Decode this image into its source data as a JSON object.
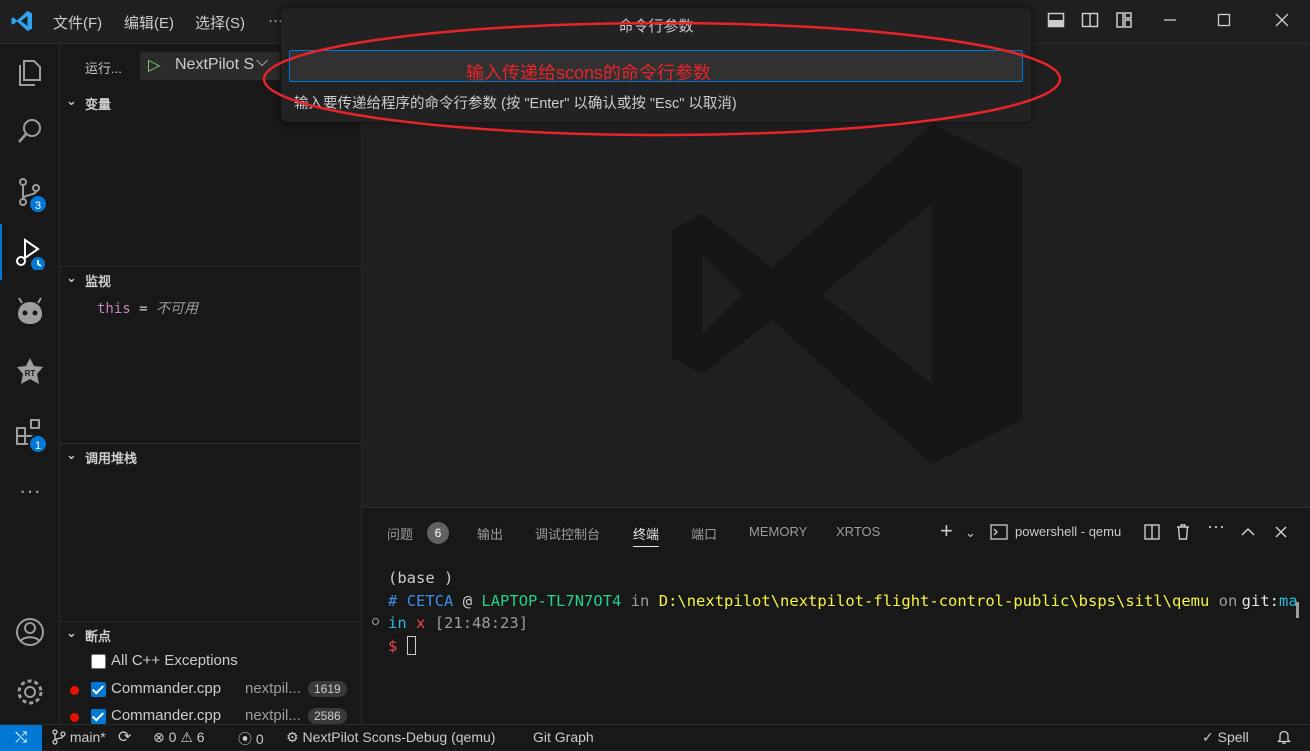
{
  "titlebar": {
    "menus": [
      "文件(F)",
      "编辑(E)",
      "选择(S)",
      "···"
    ]
  },
  "activity": {
    "scm_badge": "3",
    "extensions_badge": "1",
    "more": "···"
  },
  "sidebar": {
    "run_label": "运行...",
    "run_config": "NextPilot S",
    "variables_title": "变量",
    "watch_title": "监视",
    "watch_expr": "this",
    "watch_eq": "=",
    "watch_value": "不可用",
    "callstack_title": "调用堆栈",
    "breakpoints_title": "断点",
    "breakpoints": [
      {
        "name": "All C++ Exceptions",
        "path": "",
        "line": "",
        "checked": false,
        "dot": false
      },
      {
        "name": "Commander.cpp",
        "path": "nextpil...",
        "line": "1619",
        "checked": true,
        "dot": true
      },
      {
        "name": "Commander.cpp",
        "path": "nextpil...",
        "line": "2586",
        "checked": true,
        "dot": true
      }
    ]
  },
  "quickpick": {
    "title": "命令行参数",
    "annotation": "输入传递给scons的命令行参数",
    "hint": "输入要传递给程序的命令行参数 (按 \"Enter\" 以确认或按 \"Esc\" 以取消)"
  },
  "panel": {
    "tabs": [
      {
        "label": "问题",
        "active": false
      },
      {
        "label": "输出",
        "active": false
      },
      {
        "label": "调试控制台",
        "active": false
      },
      {
        "label": "终端",
        "active": true
      },
      {
        "label": "端口",
        "active": false
      },
      {
        "label": "MEMORY",
        "active": false
      },
      {
        "label": "XRTOS",
        "active": false
      }
    ],
    "problems_count": "6",
    "terminal_name": "powershell - qemu",
    "terminal": {
      "line1": "(base )",
      "hash": "#",
      "user": "CETCA",
      "at": "@",
      "host": "LAPTOP-TL7N7OT4",
      "in": "in",
      "path": "D:\\nextpilot\\nextpilot-flight-control-public\\bsps\\sitl\\qemu",
      "on": "on",
      "git": "git:",
      "branch_a": "ma",
      "branch_b": "in",
      "status": "x",
      "time": "[21:48:23]",
      "prompt": "$"
    }
  },
  "status": {
    "branch": "main*",
    "errors": "0",
    "warnings": "6",
    "ports": "0",
    "debug": "NextPilot Scons-Debug (qemu)",
    "git_graph": "Git Graph",
    "spell": "Spell"
  },
  "colors": {
    "accent": "#0078d4",
    "annotation_red": "#e8242b",
    "breakpoint": "#e51400"
  }
}
